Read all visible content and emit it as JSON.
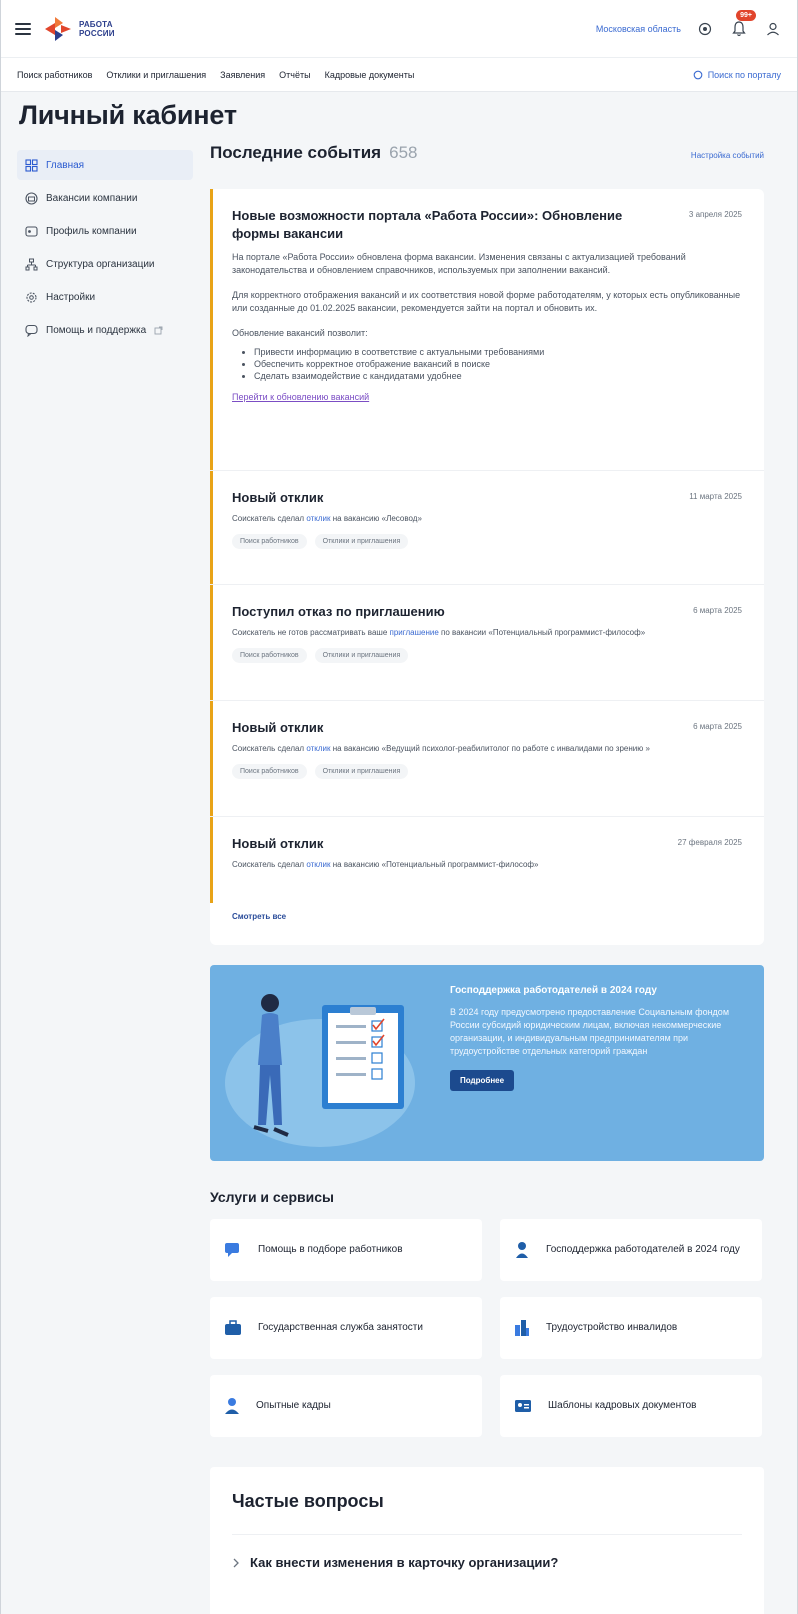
{
  "header": {
    "logo_line1": "РАБОТА",
    "logo_line2": "РОССИИ",
    "region": "Московская область",
    "notifications_badge": "99+"
  },
  "nav": {
    "items": [
      "Поиск работников",
      "Отклики и приглашения",
      "Заявления",
      "Отчёты",
      "Кадровые документы"
    ],
    "search_portal": "Поиск по порталу"
  },
  "page_title": "Личный кабинет",
  "sidebar": {
    "items": [
      {
        "label": "Главная",
        "icon": "home-icon"
      },
      {
        "label": "Вакансии компании",
        "icon": "briefcase-icon"
      },
      {
        "label": "Профиль компании",
        "icon": "profile-card-icon"
      },
      {
        "label": "Структура организации",
        "icon": "structure-icon"
      },
      {
        "label": "Настройки",
        "icon": "gear-icon"
      },
      {
        "label": "Помощь и поддержка",
        "icon": "chat-icon"
      }
    ]
  },
  "events": {
    "title": "Последние события",
    "count": "658",
    "settings_link": "Настройка событий",
    "see_all": "Смотреть все",
    "featured": {
      "title": "Новые возможности портала «Работа России»: Обновление формы вакансии",
      "date": "3 апреля 2025",
      "p1": "На портале «Работа России» обновлена форма вакансии. Изменения связаны с актуализацией требований законодательства и обновлением справочников, используемых при заполнении вакансий.",
      "p2": "Для корректного отображения вакансий и их соответствия новой форме работодателям, у которых есть опубликованные или созданные до 01.02.2025 вакансии, рекомендуется зайти на портал и обновить их.",
      "p3": "Обновление вакансий позволит:",
      "bullets": [
        "Привести информацию в соответствие с актуальными требованиями",
        "Обеспечить корректное отображение вакансий в поиске",
        "Сделать взаимодействие с кандидатами удобнее"
      ],
      "link": "Перейти к обновлению вакансий"
    },
    "items": [
      {
        "title": "Новый отклик",
        "date": "11 марта 2025",
        "desc_pre": "Соискатель сделал ",
        "desc_hl": "отклик",
        "desc_post": " на вакансию «Лесовод»",
        "tags": [
          "Поиск работников",
          "Отклики и приглашения"
        ]
      },
      {
        "title": "Поступил отказ по приглашению",
        "date": "6 марта 2025",
        "desc_pre": "Соискатель не готов рассматривать ваше ",
        "desc_hl": "приглашение",
        "desc_post": " по вакансии «Потенциальный программист-философ»",
        "tags": [
          "Поиск работников",
          "Отклики и приглашения"
        ]
      },
      {
        "title": "Новый отклик",
        "date": "6 марта 2025",
        "desc_pre": "Соискатель сделал ",
        "desc_hl": "отклик",
        "desc_post": " на вакансию «Ведущий психолог-реабилитолог по работе с инвалидами по зрению »",
        "tags": [
          "Поиск работников",
          "Отклики и приглашения"
        ]
      },
      {
        "title": "Новый отклик",
        "date": "27 февраля 2025",
        "desc_pre": "Соискатель сделал ",
        "desc_hl": "отклик",
        "desc_post": " на вакансию «Потенциальный программист-философ»",
        "tags": []
      }
    ]
  },
  "banner": {
    "title": "Господдержка работодателей в 2024 году",
    "body": "В 2024 году предусмотрено предоставление Социальным фондом России субсидий юридическим лицам, включая некоммерческие организации, и индивидуальным предпринимателям при трудоустройстве отдельных категорий граждан",
    "button": "Подробнее"
  },
  "services": {
    "title": "Услуги и сервисы",
    "items": [
      {
        "label": "Помощь в подборе работников",
        "icon": "chat-help-icon",
        "color": "#3a7be0"
      },
      {
        "label": "Господдержка работодателей в 2024 году",
        "icon": "support-person-icon",
        "color": "#1f5ea8"
      },
      {
        "label": "Государственная служба занятости",
        "icon": "case-icon",
        "color": "#1f5ea8"
      },
      {
        "label": "Трудоустройство инвалидов",
        "icon": "buildings-icon",
        "color": "#3a7be0"
      },
      {
        "label": "Опытные кадры",
        "icon": "person-icon",
        "color": "#3a7be0"
      },
      {
        "label": "Шаблоны кадровых документов",
        "icon": "id-card-icon",
        "color": "#1f5ea8"
      }
    ]
  },
  "faq": {
    "title": "Частые вопросы",
    "questions": [
      "Как внести изменения в карточку организации?"
    ]
  },
  "colors": {
    "accent": "#3a6ad1",
    "event_marker": "#e8a317",
    "banner_bg": "#6fb0e2",
    "badge": "#e1452c"
  }
}
